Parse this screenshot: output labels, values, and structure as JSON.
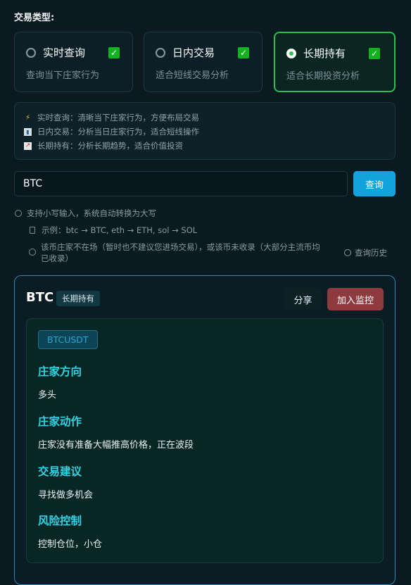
{
  "section_label": "交易类型:",
  "types": [
    {
      "title": "实时查询",
      "desc": "查询当下庄家行为",
      "selected": false
    },
    {
      "title": "日内交易",
      "desc": "适合短线交易分析",
      "selected": false
    },
    {
      "title": "长期持有",
      "desc": "适合长期投资分析",
      "selected": true
    }
  ],
  "info_lines": [
    {
      "icon": "lightning-icon",
      "text": "实时查询：清晰当下庄家行为，方便布局交易"
    },
    {
      "icon": "bar-chart-icon",
      "text": "日内交易：分析当日庄家行为，适合短线操作"
    },
    {
      "icon": "trend-up-icon",
      "text": "长期持有：分析长期趋势，适合价值投资"
    }
  ],
  "search": {
    "value": "BTC",
    "button": "查询"
  },
  "hints": {
    "lowercase": "支持小写输入，系统自动转换为大写",
    "example": "示例：btc → BTC, eth → ETH, sol → SOL",
    "warning_line1": "该币庄家不在场（暂时也不建议您进场交易），或该币未收录（大部分主流币均",
    "warning_line2": "已收录）",
    "history": "查询历史"
  },
  "result": {
    "coin": "BTC",
    "tag": "长期持有",
    "share": "分享",
    "monitor": "加入监控",
    "pair": "BTCUSDT",
    "sections": [
      {
        "title": "庄家方向",
        "body": "多头"
      },
      {
        "title": "庄家动作",
        "body": "庄家没有准备大幅推高价格，正在波段"
      },
      {
        "title": "交易建议",
        "body": "寻找做多机会"
      },
      {
        "title": "风险控制",
        "body": "控制仓位，小仓"
      }
    ]
  },
  "colors": {
    "accent": "#2ec04f",
    "primary_button": "#13a3dc",
    "monitor_button": "#8e3a3e",
    "section_title": "#2dd4e6"
  }
}
